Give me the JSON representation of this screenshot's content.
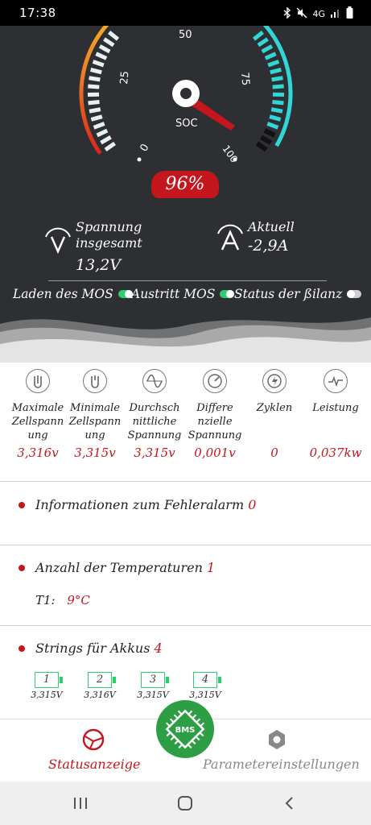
{
  "status_bar": {
    "time": "17:38",
    "network": "4G"
  },
  "gauge": {
    "ticks": [
      "0",
      "25",
      "50",
      "75",
      "100"
    ],
    "center_label": "SOC",
    "soc_value": "96%",
    "soc_fraction": 0.96
  },
  "metrics": {
    "voltage_label_1": "Spannung",
    "voltage_label_2": "insgesamt",
    "voltage_value": "13,2V",
    "current_label": "Aktuell",
    "current_value": "-2,9A"
  },
  "toggles": [
    {
      "label": "Laden des MOS",
      "on": true
    },
    {
      "label": "Austritt MOS",
      "on": true
    },
    {
      "label": "Status der ßilanz",
      "on": false
    }
  ],
  "cells": [
    {
      "icon": "max-cell-voltage-icon",
      "label": "Maximale Zellspann ung",
      "value": "3,316v"
    },
    {
      "icon": "min-cell-voltage-icon",
      "label": "Minimale Zellspann ung",
      "value": "3,315v"
    },
    {
      "icon": "average-voltage-icon",
      "label": "Durchsch nittliche Spannung",
      "value": "3,315v"
    },
    {
      "icon": "differential-voltage-icon",
      "label": "Differe nzielle Spannung",
      "value": "0,001v"
    },
    {
      "icon": "cycles-icon",
      "label": "Zyklen",
      "value": "0"
    },
    {
      "icon": "power-icon",
      "label": "Leistung",
      "value": "0,037kw"
    }
  ],
  "fault": {
    "label": "Informationen zum Fehleralarm",
    "count": "0"
  },
  "temperature": {
    "label": "Anzahl der Temperaturen",
    "count": "1",
    "t1_label": "T1:",
    "t1_value": "9°C"
  },
  "strings": {
    "label": "Strings für Akkus",
    "count": "4",
    "batteries": [
      {
        "index": "1",
        "voltage": "3,315V"
      },
      {
        "index": "2",
        "voltage": "3,316V"
      },
      {
        "index": "3",
        "voltage": "3,315V"
      },
      {
        "index": "4",
        "voltage": "3,315V"
      }
    ]
  },
  "bottom_nav": {
    "status_label": "Statusanzeige",
    "params_label": "Parametereinstellungen",
    "center_label": "BMS"
  },
  "colors": {
    "accent": "#c4161c",
    "green": "#2ecc71",
    "cyan": "#31d7d7",
    "dark_bg": "#2e2f33"
  }
}
